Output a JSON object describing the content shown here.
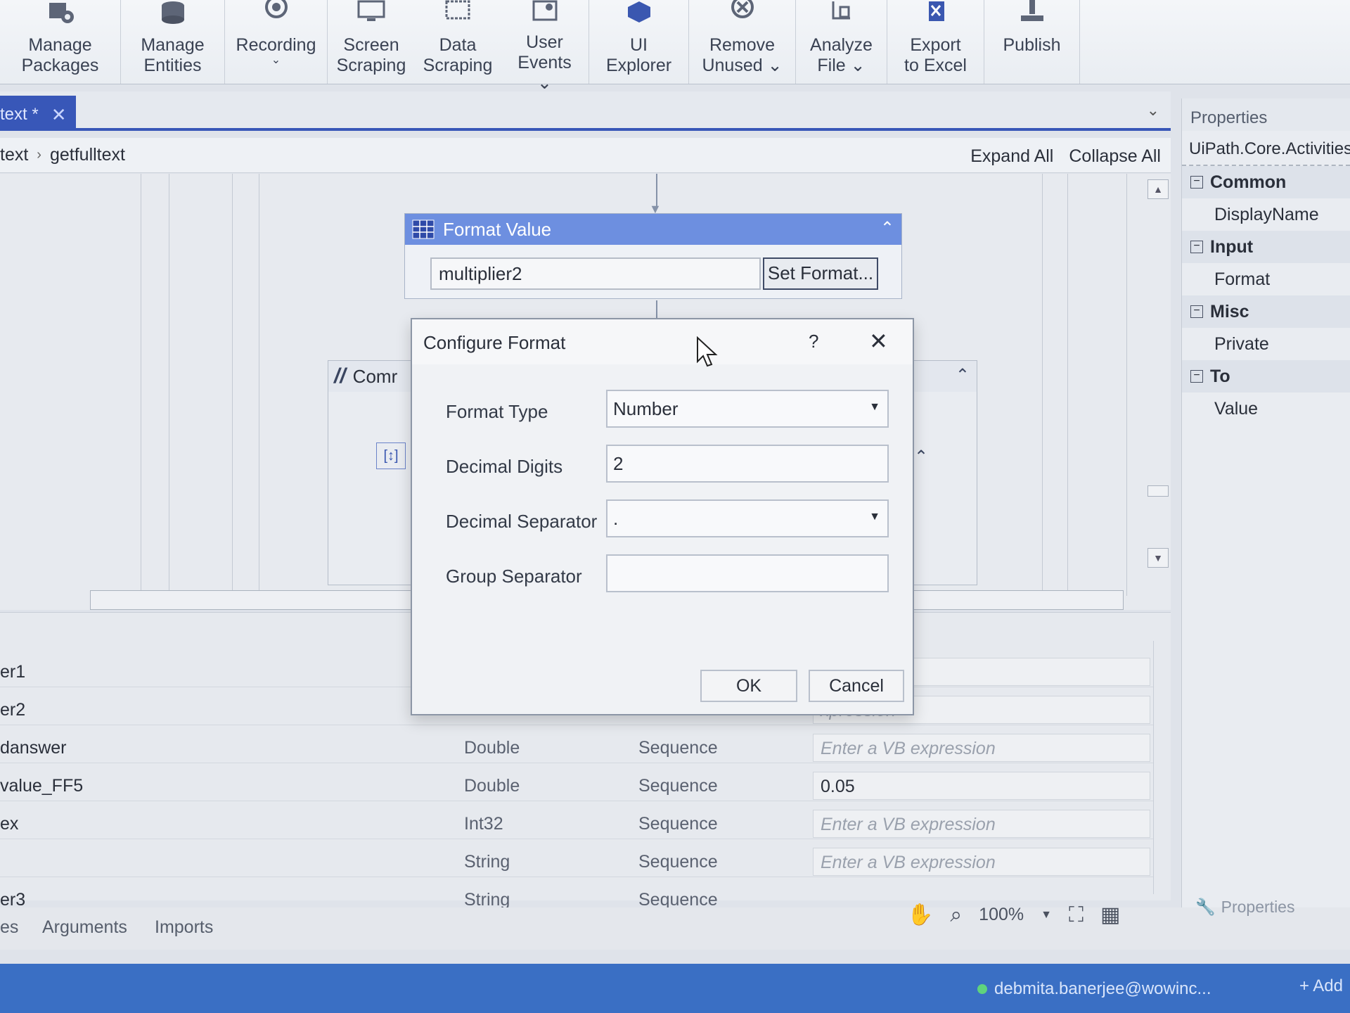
{
  "ribbon": {
    "buttons": [
      {
        "label": "Manage\nPackages",
        "icon": "packages-icon"
      },
      {
        "label": "Manage\nEntities",
        "icon": "entities-icon"
      },
      {
        "label": "Recording",
        "icon": "record-icon",
        "caret": "⌄"
      },
      {
        "label": "Screen\nScraping",
        "icon": "screen-scraping-icon"
      },
      {
        "label": "Data\nScraping",
        "icon": "data-scraping-icon"
      },
      {
        "label": "User\nEvents ⌄",
        "icon": "user-events-icon"
      },
      {
        "label": "UI\nExplorer",
        "icon": "ui-explorer-icon"
      },
      {
        "label": "Remove\nUnused ⌄",
        "icon": "remove-unused-icon"
      },
      {
        "label": "Analyze\nFile ⌄",
        "icon": "analyze-file-icon"
      },
      {
        "label": "Export\nto Excel",
        "icon": "export-excel-icon"
      },
      {
        "label": "Publish",
        "icon": "publish-icon"
      }
    ]
  },
  "tab": {
    "label": "text *",
    "close": "✕"
  },
  "breadcrumb": {
    "root": "text",
    "current": "getfulltext",
    "expand_all": "Expand All",
    "collapse_all": "Collapse All"
  },
  "activity": {
    "title": "Format Value",
    "value": "multiplier2",
    "set_format": "Set Format..."
  },
  "comment": {
    "title": "Comr"
  },
  "properties": {
    "title": "Properties",
    "type": "UiPath.Core.Activities.I",
    "rows": [
      {
        "kind": "cat",
        "label": "Common"
      },
      {
        "kind": "item",
        "label": "DisplayName"
      },
      {
        "kind": "cat",
        "label": "Input"
      },
      {
        "kind": "item",
        "label": "Format"
      },
      {
        "kind": "cat",
        "label": "Misc"
      },
      {
        "kind": "item",
        "label": "Private"
      },
      {
        "kind": "cat",
        "label": "To"
      },
      {
        "kind": "item",
        "label": "Value"
      }
    ]
  },
  "variables": {
    "rows": [
      {
        "name": "er1",
        "type": "",
        "scope": "",
        "default": "xpression",
        "placeholder": true
      },
      {
        "name": "er2",
        "type": "",
        "scope": "",
        "default": "xpression",
        "placeholder": true
      },
      {
        "name": "danswer",
        "type": "Double",
        "scope": "Sequence",
        "default": "Enter a VB expression",
        "placeholder": true
      },
      {
        "name": "value_FF5",
        "type": "Double",
        "scope": "Sequence",
        "default": "0.05",
        "placeholder": false
      },
      {
        "name": "ex",
        "type": "Int32",
        "scope": "Sequence",
        "default": "Enter a VB expression",
        "placeholder": true
      },
      {
        "name": "",
        "type": "String",
        "scope": "Sequence",
        "default": "Enter a VB expression",
        "placeholder": true
      },
      {
        "name": "er3",
        "type": "String",
        "scope": "Sequence",
        "default": "Enter a VB expression",
        "placeholder": true
      }
    ]
  },
  "bottom_tabs": {
    "variables": "es",
    "arguments": "Arguments",
    "imports": "Imports"
  },
  "zoom": {
    "level": "100%"
  },
  "props_tab": "Properties",
  "status": {
    "user": "debmita.banerjee@wowinc...",
    "add": "+ Add"
  },
  "dialog": {
    "title": "Configure Format",
    "help": "?",
    "close": "✕",
    "format_type_label": "Format Type",
    "format_type_value": "Number",
    "decimal_digits_label": "Decimal Digits",
    "decimal_digits_value": "2",
    "decimal_separator_label": "Decimal Separator",
    "decimal_separator_value": ".",
    "group_separator_label": "Group Separator",
    "group_separator_value": "",
    "ok": "OK",
    "cancel": "Cancel"
  },
  "colors": {
    "accent": "#3857b8",
    "activity_header": "#6d8fe0",
    "status_bar": "#3a6fc4"
  }
}
